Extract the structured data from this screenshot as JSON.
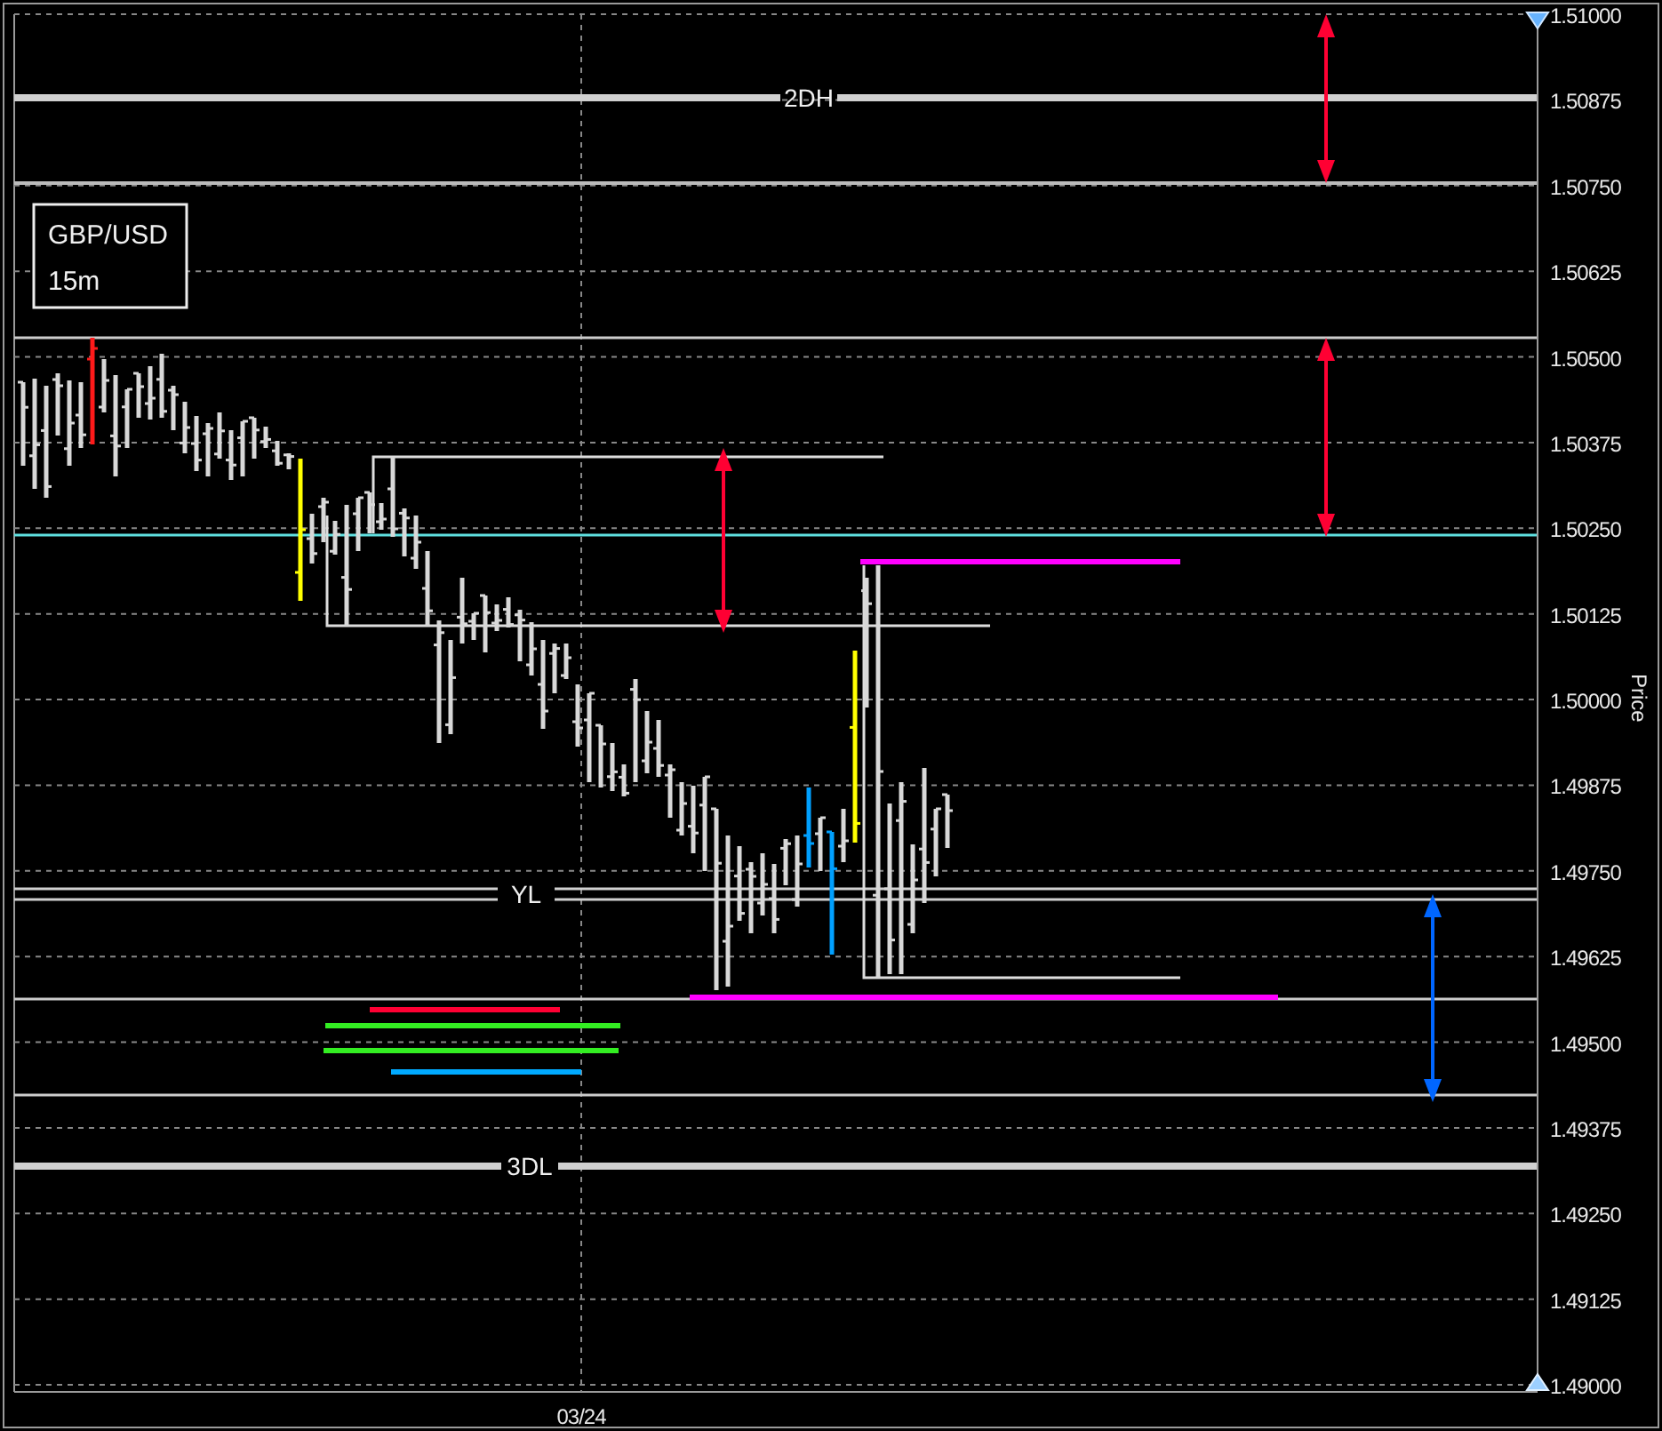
{
  "symbol_box": {
    "pair": "GBP/USD",
    "timeframe": "15m"
  },
  "price_axis": {
    "title": "Price",
    "tick_labels": [
      "1.51000",
      "1.50875",
      "1.50750",
      "1.50625",
      "1.50500",
      "1.50375",
      "1.50250",
      "1.50125",
      "1.50000",
      "1.49875",
      "1.49750",
      "1.49625",
      "1.49500",
      "1.49375",
      "1.49250",
      "1.49125",
      "1.49000"
    ]
  },
  "level_labels": [
    "2DH",
    "YL",
    "3DL"
  ],
  "date_labels": [
    "03/24"
  ]
}
